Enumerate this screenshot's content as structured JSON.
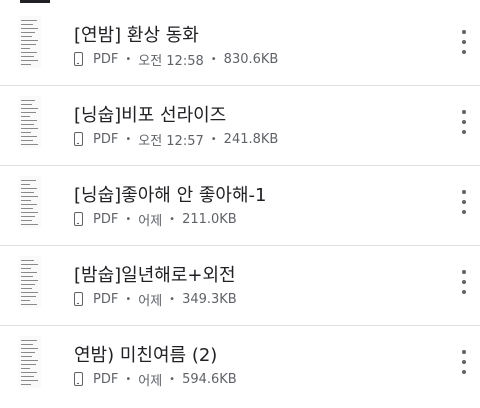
{
  "files": [
    {
      "title": "[연밤] 환상 동화",
      "type": "PDF",
      "date": "오전 12:58",
      "size": "830.6KB"
    },
    {
      "title": "[닝숩]비포 선라이즈",
      "type": "PDF",
      "date": "오전 12:57",
      "size": "241.8KB"
    },
    {
      "title": "[닝숩]좋아해 안 좋아해-1",
      "type": "PDF",
      "date": "어제",
      "size": "211.0KB"
    },
    {
      "title": "[밤숩]일년해로+외전",
      "type": "PDF",
      "date": "어제",
      "size": "349.3KB"
    },
    {
      "title": "연밤) 미친여름 (2)",
      "type": "PDF",
      "date": "어제",
      "size": "594.6KB"
    }
  ],
  "icons": {
    "thumbnail": "document-thumbnail-icon",
    "device": "phone-icon",
    "more": "more-vert-icon"
  },
  "colors": {
    "text_primary": "#202124",
    "text_secondary": "#5f6368",
    "divider": "#e0e0e0"
  }
}
